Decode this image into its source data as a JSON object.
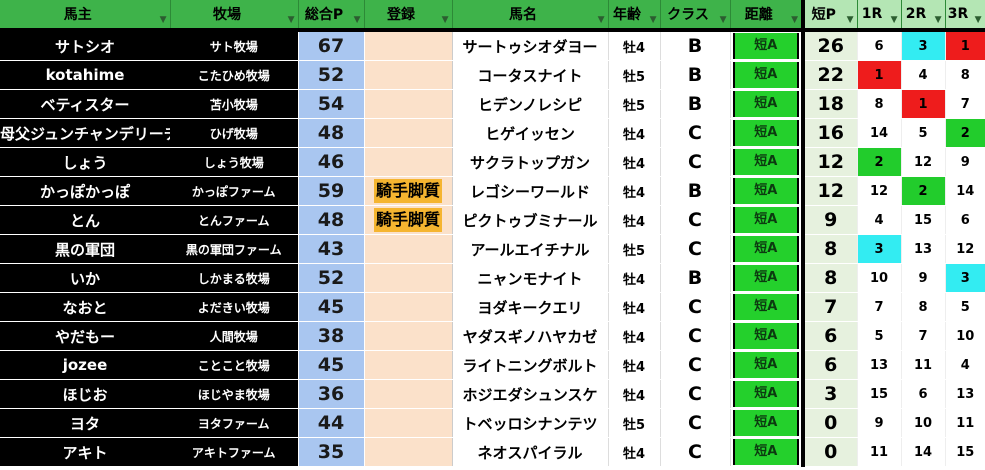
{
  "headers": {
    "owner": "馬主",
    "farm": "牧場",
    "sogo": "総合P",
    "toroku": "登録",
    "horse": "馬名",
    "age": "年齢",
    "cls": "クラス",
    "dist": "距離",
    "short": "短P",
    "r1": "1R",
    "r2": "2R",
    "r3": "3R"
  },
  "filter_icon": "dropdown-arrow",
  "colors": {
    "red": "#ee1c1c",
    "green": "#22cc2c",
    "cyan": "#33ecf2"
  },
  "rows": [
    {
      "owner": "サトシオ",
      "farm": "サト牧場",
      "sogo": "67",
      "toroku": "",
      "horse": "サートゥシオダヨー",
      "age": "牡4",
      "cls": "B",
      "dist": "短A",
      "short": "26",
      "r1": "6",
      "r2": "3",
      "r3": "1",
      "c1": "",
      "c2": "cyan",
      "c3": "red"
    },
    {
      "owner": "kotahime",
      "farm": "こたひめ牧場",
      "sogo": "52",
      "toroku": "",
      "horse": "コータスナイト",
      "age": "牡5",
      "cls": "B",
      "dist": "短A",
      "short": "22",
      "r1": "1",
      "r2": "4",
      "r3": "8",
      "c1": "red",
      "c2": "",
      "c3": ""
    },
    {
      "owner": "ベティスター",
      "farm": "苫小牧場",
      "sogo": "54",
      "toroku": "",
      "horse": "ヒデンノレシピ",
      "age": "牡5",
      "cls": "B",
      "dist": "短A",
      "short": "18",
      "r1": "8",
      "r2": "1",
      "r3": "7",
      "c1": "",
      "c2": "red",
      "c3": ""
    },
    {
      "owner": "母父ジュンチャンデリーチ",
      "farm": "ひげ牧場",
      "sogo": "48",
      "toroku": "",
      "horse": "ヒゲイッセン",
      "age": "牡4",
      "cls": "C",
      "dist": "短A",
      "short": "16",
      "r1": "14",
      "r2": "5",
      "r3": "2",
      "c1": "",
      "c2": "",
      "c3": "green"
    },
    {
      "owner": "しょう",
      "farm": "しょう牧場",
      "sogo": "46",
      "toroku": "",
      "horse": "サクラトップガン",
      "age": "牡4",
      "cls": "C",
      "dist": "短A",
      "short": "12",
      "r1": "2",
      "r2": "12",
      "r3": "9",
      "c1": "green",
      "c2": "",
      "c3": ""
    },
    {
      "owner": "かっぽかっぽ",
      "farm": "かっぽファーム",
      "sogo": "59",
      "toroku": "騎手脚質",
      "horse": "レゴシーワールド",
      "age": "牡4",
      "cls": "B",
      "dist": "短A",
      "short": "12",
      "r1": "12",
      "r2": "2",
      "r3": "14",
      "c1": "",
      "c2": "green",
      "c3": ""
    },
    {
      "owner": "とん",
      "farm": "とんファーム",
      "sogo": "48",
      "toroku": "騎手脚質",
      "horse": "ピクトゥブミナール",
      "age": "牡4",
      "cls": "C",
      "dist": "短A",
      "short": "9",
      "r1": "4",
      "r2": "15",
      "r3": "6",
      "c1": "",
      "c2": "",
      "c3": ""
    },
    {
      "owner": "黒の軍団",
      "farm": "黒の軍団ファーム",
      "sogo": "43",
      "toroku": "",
      "horse": "アールエイチナル",
      "age": "牡5",
      "cls": "C",
      "dist": "短A",
      "short": "8",
      "r1": "3",
      "r2": "13",
      "r3": "12",
      "c1": "cyan",
      "c2": "",
      "c3": ""
    },
    {
      "owner": "いか",
      "farm": "しかまる牧場",
      "sogo": "52",
      "toroku": "",
      "horse": "ニャンモナイト",
      "age": "牡4",
      "cls": "B",
      "dist": "短A",
      "short": "8",
      "r1": "10",
      "r2": "9",
      "r3": "3",
      "c1": "",
      "c2": "",
      "c3": "cyan"
    },
    {
      "owner": "なおと",
      "farm": "よだきい牧場",
      "sogo": "45",
      "toroku": "",
      "horse": "ヨダキークエリ",
      "age": "牡4",
      "cls": "C",
      "dist": "短A",
      "short": "7",
      "r1": "7",
      "r2": "8",
      "r3": "5",
      "c1": "",
      "c2": "",
      "c3": ""
    },
    {
      "owner": "やだもー",
      "farm": "人間牧場",
      "sogo": "38",
      "toroku": "",
      "horse": "ヤダスギノハヤカゼ",
      "age": "牡4",
      "cls": "C",
      "dist": "短A",
      "short": "6",
      "r1": "5",
      "r2": "7",
      "r3": "10",
      "c1": "",
      "c2": "",
      "c3": ""
    },
    {
      "owner": "jozee",
      "farm": "ことこと牧場",
      "sogo": "45",
      "toroku": "",
      "horse": "ライトニングボルト",
      "age": "牡4",
      "cls": "C",
      "dist": "短A",
      "short": "6",
      "r1": "13",
      "r2": "11",
      "r3": "4",
      "c1": "",
      "c2": "",
      "c3": ""
    },
    {
      "owner": "ほじお",
      "farm": "ほじやま牧場",
      "sogo": "36",
      "toroku": "",
      "horse": "ホジエダシュンスケ",
      "age": "牡4",
      "cls": "C",
      "dist": "短A",
      "short": "3",
      "r1": "15",
      "r2": "6",
      "r3": "13",
      "c1": "",
      "c2": "",
      "c3": ""
    },
    {
      "owner": "ヨタ",
      "farm": "ヨタファーム",
      "sogo": "44",
      "toroku": "",
      "horse": "トベッロシナンテツ",
      "age": "牡5",
      "cls": "C",
      "dist": "短A",
      "short": "0",
      "r1": "9",
      "r2": "10",
      "r3": "11",
      "c1": "",
      "c2": "",
      "c3": ""
    },
    {
      "owner": "アキト",
      "farm": "アキトファーム",
      "sogo": "35",
      "toroku": "",
      "horse": "ネオスパイラル",
      "age": "牡4",
      "cls": "C",
      "dist": "短A",
      "short": "0",
      "r1": "11",
      "r2": "14",
      "r3": "15",
      "c1": "",
      "c2": "",
      "c3": ""
    }
  ]
}
